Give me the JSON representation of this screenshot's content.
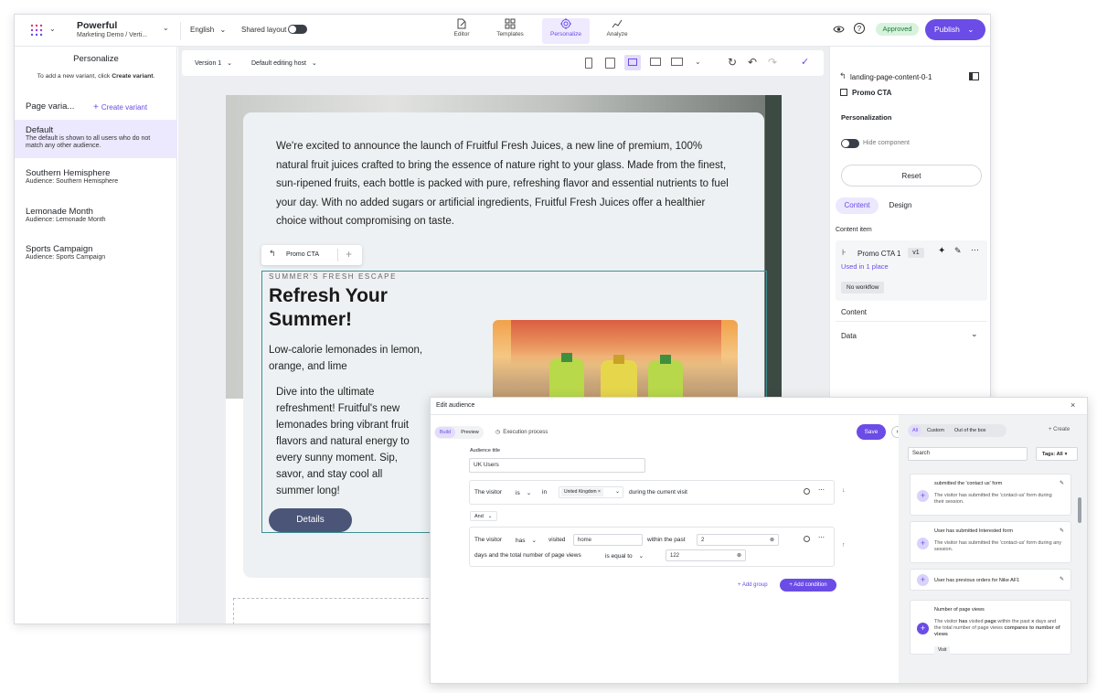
{
  "topbar": {
    "brand": "Powerful",
    "brand_sub": "Marketing Demo / Verti...",
    "language": "English",
    "shared_layout": "Shared layout",
    "tabs": [
      "Editor",
      "Templates",
      "Personalize",
      "Analyze"
    ],
    "status_badge": "Approved",
    "publish": "Publish"
  },
  "left_panel": {
    "title": "Personalize",
    "hint_prefix": "To add a new variant, click ",
    "hint_bold": "Create variant",
    "hint_suffix": ".",
    "section": "Page varia...",
    "create_variant": "Create variant",
    "variants": [
      {
        "name": "Default",
        "sub": "The default is shown to all users who do not match any other audience."
      },
      {
        "name": "Southern Hemisphere",
        "sub": "Audience: Southern Hemisphere"
      },
      {
        "name": "Lemonade Month",
        "sub": "Audience: Lemonade Month"
      },
      {
        "name": "Sports Campaign",
        "sub": "Audience: Sports Campaign"
      }
    ]
  },
  "canvas": {
    "version": "Version 1",
    "host": "Default editing host",
    "intro_text": "We're excited to announce the launch of Fruitful Fresh Juices, a new line of premium, 100% natural fruit juices crafted to bring the essence of nature right to your glass. Made from the finest, sun-ripened fruits, each bottle is packed with pure, refreshing flavor and essential nutrients to fuel your day. With no added sugars or artificial ingredients, Fruitful Fresh Juices offer a healthier choice without compromising on taste.",
    "chip_label": "Promo CTA",
    "eyebrow": "SUMMER'S FRESH ESCAPE",
    "heading": "Refresh Your Summer!",
    "subheading": "Low-calorie lemonades in lemon, orange, and lime",
    "body": "Dive into the ultimate refreshment! Fruitful's new lemonades bring vibrant fruit flavors and natural energy to every sunny moment. Sip, savor, and stay cool all summer long!",
    "button": "Details"
  },
  "right_panel": {
    "breadcrumb": "landing-page-content-0-1",
    "component": "Promo CTA",
    "personalization": "Personalization",
    "hide_component": "Hide component",
    "reset": "Reset",
    "tabs": [
      "Content",
      "Design"
    ],
    "content_item_label": "Content item",
    "item_name": "Promo CTA 1",
    "item_version": "v1",
    "used_in": "Used in 1 place",
    "workflow": "No workflow",
    "content_section": "Content",
    "data_section": "Data"
  },
  "audience": {
    "window_title": "Edit audience",
    "tabs": [
      "Build",
      "Preview"
    ],
    "execution": "Execution process",
    "save": "Save",
    "audience_title_label": "Audience title",
    "audience_title_value": "UK Users",
    "rule1": {
      "subject": "The visitor",
      "op": "is",
      "in": "in",
      "tag": "United Kingdom",
      "tail": "during the current visit"
    },
    "and_label": "And",
    "rule2": {
      "subject": "The visitor",
      "op": "has",
      "verb": "visited",
      "page": "home",
      "within": "within the past",
      "days_value": "2",
      "line2": "days and the total number of page views",
      "compare": "is equal to",
      "views_value": "122"
    },
    "add_group": "Add group",
    "add_condition": "Add condition",
    "filters": [
      "All",
      "Custom",
      "Out of the box"
    ],
    "create": "Create",
    "search_placeholder": "Search",
    "tags": "Tags: All",
    "cards": [
      {
        "title": "submitted the 'contact us' form",
        "desc": "The visitor has submitted the 'contact-us' form during their session."
      },
      {
        "title": "User has submitted Interested form",
        "desc": "The visitor has submitted the 'contact-us' form during any session."
      },
      {
        "title": "User has previous orders for Nike AF1",
        "desc": ""
      },
      {
        "title": "Number of page views",
        "desc_parts": [
          "The visitor ",
          "has",
          " visited ",
          "page",
          " within the past ",
          "x",
          " days and the total number of page views ",
          "compares to",
          " ",
          "number of views"
        ],
        "chip": "Visit"
      }
    ]
  },
  "colors": {
    "accent": "#6b4ce6",
    "approved_bg": "#d7f3dd",
    "approved_fg": "#1f7a3d",
    "selected_variant": "#ece8fd",
    "details_button": "#4a5577"
  }
}
